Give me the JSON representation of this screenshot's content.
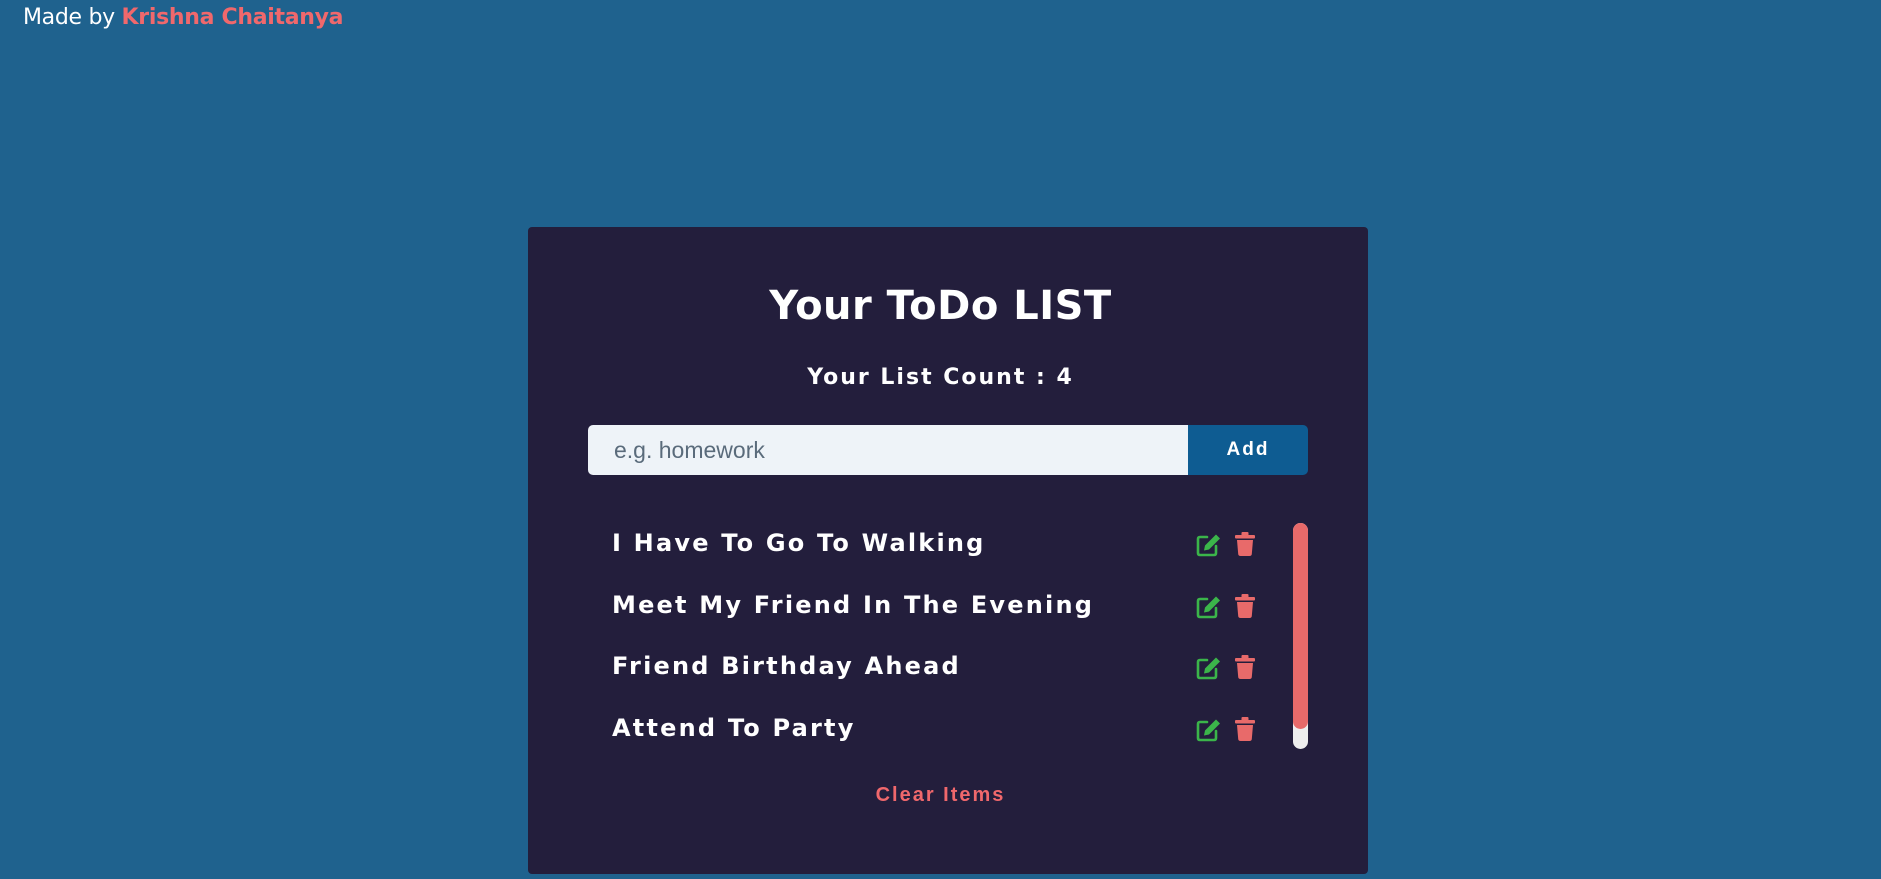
{
  "credit": {
    "prefix": "Made by ",
    "author": "Krishna Chaitanya"
  },
  "todo": {
    "title": "Your ToDo LIST",
    "count_text": "Your List Count : 4",
    "input": {
      "placeholder": "e.g. homework",
      "value": ""
    },
    "add_label": "Add",
    "items": [
      {
        "text": "I Have To Go To Walking",
        "edit_icon": "edit-icon",
        "delete_icon": "trash-icon"
      },
      {
        "text": "Meet My Friend In The Evening",
        "edit_icon": "edit-icon",
        "delete_icon": "trash-icon"
      },
      {
        "text": "Friend Birthday Ahead",
        "edit_icon": "edit-icon",
        "delete_icon": "trash-icon"
      },
      {
        "text": "Attend To Party",
        "edit_icon": "edit-icon",
        "delete_icon": "trash-icon"
      }
    ],
    "clear_label": "Clear Items"
  },
  "colors": {
    "page_background": "#1f628e",
    "card_background": "#231e3c",
    "accent_red": "#f0686c",
    "add_button": "#0e5c92",
    "edit_green": "#3bb54a",
    "scroll_thumb": "#e86a6a"
  }
}
